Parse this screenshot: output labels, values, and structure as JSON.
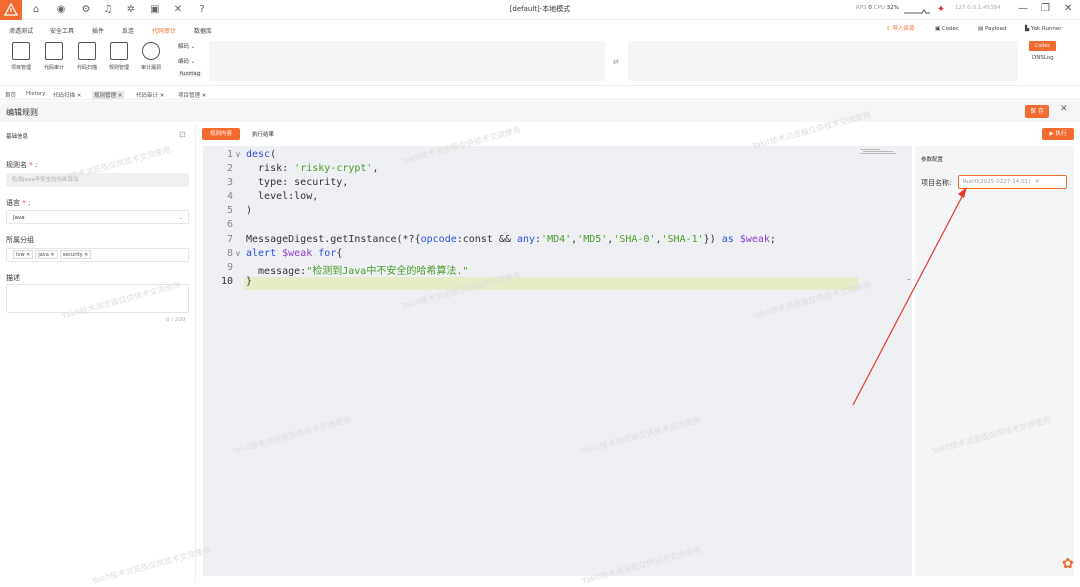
{
  "titlebar": {
    "title": "[default]-本地模式",
    "status_rps_label": "RPS",
    "status_rps_value": "0",
    "status_cpu_label": "CPU",
    "status_cpu_value": "32%",
    "address": "127.0.0.1:45384"
  },
  "menu": {
    "items": [
      "渗透测试",
      "安全工具",
      "插件",
      "反连",
      "代码审计",
      "数据库"
    ],
    "active_index": 4,
    "import_label": "导入资源",
    "codec_label": "Codec",
    "payload_label": "Payload",
    "runner_label": "Yak Runner"
  },
  "toolbar": {
    "tools": [
      "项目管理",
      "代码审计",
      "代码扫描",
      "规则管理",
      "审计漏洞"
    ],
    "decode_label": "解码",
    "encode_label": "编码",
    "fuzztag_label": "fuzztag",
    "codec_btn": "Codec",
    "dnslog_label": "DNSLog"
  },
  "tabs": {
    "home": "首页",
    "history": "History",
    "items": [
      "代码扫描",
      "规则管理",
      "代码审计",
      "项目管理"
    ]
  },
  "edit": {
    "title": "编辑规则",
    "save": "保 存"
  },
  "left": {
    "basic_info": "基础信息",
    "rule_name_label": "规则名",
    "rule_name_placeholder": "检测Java不安全的哈希算法",
    "language_label": "语言",
    "language_value": "Java",
    "group_label": "所属分组",
    "tags": [
      "low",
      "java",
      "security"
    ],
    "desc_label": "描述",
    "desc_count": "0 / 200"
  },
  "editor": {
    "tab_content": "规则内容",
    "tab_result": "执行结果",
    "exec_label": "执行",
    "line_numbers": [
      "1",
      "2",
      "3",
      "4",
      "5",
      "6",
      "7",
      "8",
      "9",
      "10"
    ]
  },
  "right": {
    "title": "参数配置",
    "project_label": "项目名称:",
    "project_value": "RuoYi(2025-0227-14:01)"
  },
  "watermark": "Yakit技术浏览版仅供技术交流使用",
  "colors": {
    "accent": "#f26a2e",
    "keyword": "#2b4fe0",
    "string": "#4a9b2c",
    "highlight": "#e6edc8"
  }
}
